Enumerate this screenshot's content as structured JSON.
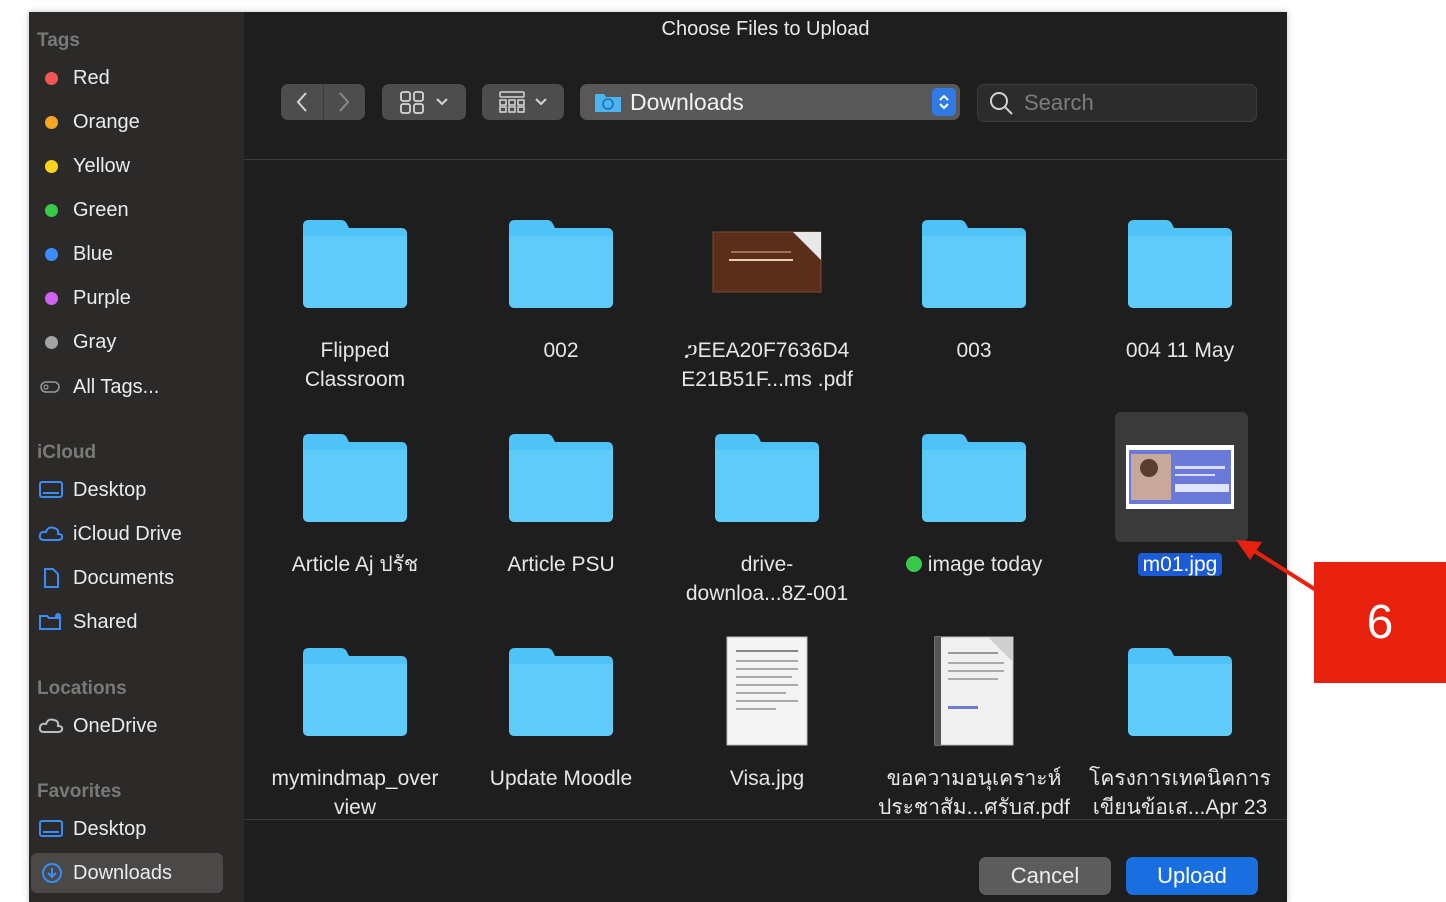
{
  "dialog": {
    "title": "Choose Files to Upload"
  },
  "sidebar": {
    "tags_header": "Tags",
    "tags": [
      {
        "label": "Red",
        "color": "#f05454"
      },
      {
        "label": "Orange",
        "color": "#f5a623"
      },
      {
        "label": "Yellow",
        "color": "#f7d51d"
      },
      {
        "label": "Green",
        "color": "#36c94a"
      },
      {
        "label": "Blue",
        "color": "#3a8dff"
      },
      {
        "label": "Purple",
        "color": "#d161f0"
      },
      {
        "label": "Gray",
        "color": "#a3a3a3"
      }
    ],
    "all_tags": "All Tags...",
    "icloud_header": "iCloud",
    "icloud": [
      {
        "label": "Desktop",
        "icon": "desktop-icon"
      },
      {
        "label": "iCloud Drive",
        "icon": "cloud-icon"
      },
      {
        "label": "Documents",
        "icon": "document-icon"
      },
      {
        "label": "Shared",
        "icon": "shared-folder-icon"
      }
    ],
    "locations_header": "Locations",
    "locations": [
      {
        "label": "OneDrive",
        "icon": "cloud-icon"
      }
    ],
    "favorites_header": "Favorites",
    "favorites": [
      {
        "label": "Desktop",
        "icon": "desktop-icon"
      },
      {
        "label": "Downloads",
        "icon": "download-icon",
        "selected": true
      }
    ]
  },
  "toolbar": {
    "location": "Downloads",
    "search_placeholder": "Search"
  },
  "files": [
    {
      "line1": "Flipped",
      "line2": "Classroom",
      "kind": "folder"
    },
    {
      "line1": "002",
      "line2": "",
      "kind": "folder"
    },
    {
      "line1": "ጋEEA20F7636D4",
      "line2": "E21B51F...ms .pdf",
      "kind": "pdf-dark"
    },
    {
      "line1": "003",
      "line2": "",
      "kind": "folder"
    },
    {
      "line1": "004 11 May",
      "line2": "",
      "kind": "folder"
    },
    {
      "line1": "Article Aj ปรัช",
      "line2": "",
      "kind": "folder"
    },
    {
      "line1": "Article PSU",
      "line2": "",
      "kind": "folder"
    },
    {
      "line1": "drive-",
      "line2": "downloa...8Z-001",
      "kind": "folder"
    },
    {
      "line1": "image today",
      "line2": "",
      "kind": "folder",
      "tag_color": "#36c94a"
    },
    {
      "line1": "m01.jpg",
      "line2": "",
      "kind": "image",
      "selected": true
    },
    {
      "line1": "mymindmap_over",
      "line2": "view",
      "kind": "folder"
    },
    {
      "line1": "Update Moodle",
      "line2": "",
      "kind": "folder"
    },
    {
      "line1": "Visa.jpg",
      "line2": "",
      "kind": "doc"
    },
    {
      "line1": "ขอความอนุเคราะห์",
      "line2": "ประชาสัม...ศรับส.pdf",
      "kind": "doc-pdf"
    },
    {
      "line1": "โครงการเทคนิคการ",
      "line2": "เขียนข้อเส...Apr 23",
      "kind": "folder"
    }
  ],
  "buttons": {
    "cancel": "Cancel",
    "upload": "Upload"
  },
  "annotation": {
    "step": "6"
  }
}
